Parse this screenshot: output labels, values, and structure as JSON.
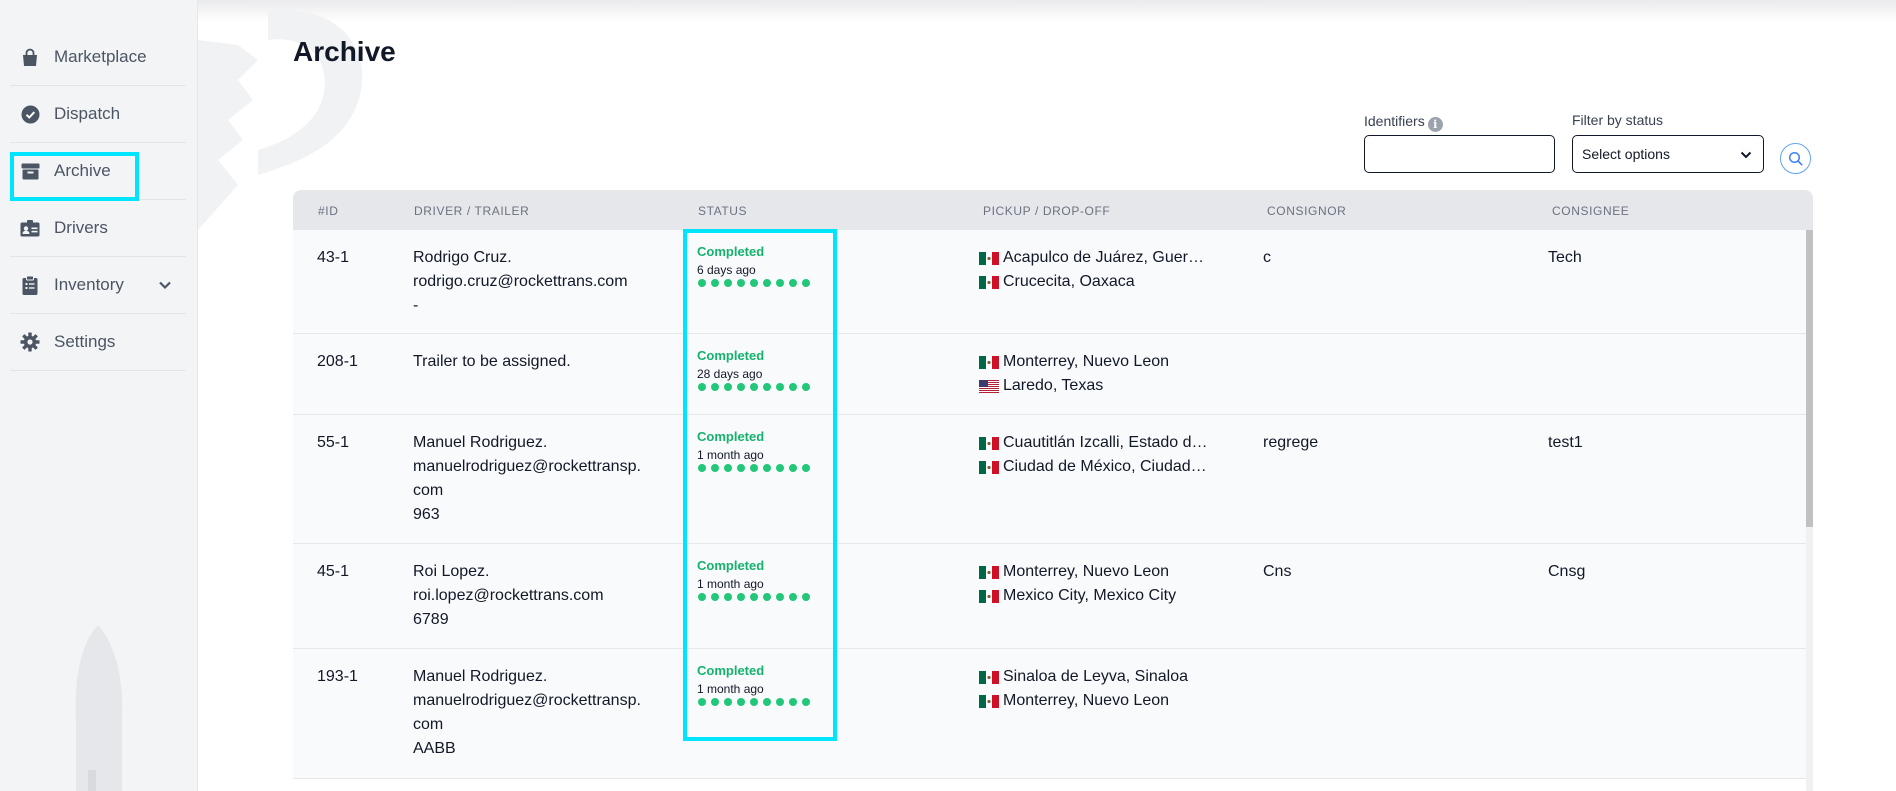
{
  "sidebar": {
    "items": [
      {
        "label": "Marketplace",
        "icon": "shopping-bag-icon",
        "active": false
      },
      {
        "label": "Dispatch",
        "icon": "check-circle-icon",
        "active": false
      },
      {
        "label": "Archive",
        "icon": "archive-box-icon",
        "active": true
      },
      {
        "label": "Drivers",
        "icon": "id-card-icon",
        "active": false
      },
      {
        "label": "Inventory",
        "icon": "clipboard-icon",
        "active": false,
        "expandable": true
      },
      {
        "label": "Settings",
        "icon": "gear-icon",
        "active": false
      }
    ]
  },
  "page": {
    "title": "Archive"
  },
  "filters": {
    "identifiers_label": "Identifiers",
    "identifiers_value": "",
    "status_label": "Filter by status",
    "status_placeholder": "Select options"
  },
  "table": {
    "headers": [
      "#ID",
      "DRIVER / TRAILER",
      "STATUS",
      "PICKUP / DROP-OFF",
      "CONSIGNOR",
      "CONSIGNEE"
    ],
    "rows": [
      {
        "id": "43-1",
        "driver_lines": [
          "Rodrigo Cruz.",
          "rodrigo.cruz@rockettrans.com",
          "-"
        ],
        "status": "Completed",
        "status_time": "6 days ago",
        "pickup": {
          "flag": "MX",
          "text": "Acapulco de Juárez, Guerr…"
        },
        "dropoff": {
          "flag": "MX",
          "text": "Crucecita, Oaxaca"
        },
        "consignor": "c",
        "consignee": "Tech"
      },
      {
        "id": "208-1",
        "driver_lines": [
          "Trailer to be assigned."
        ],
        "status": "Completed",
        "status_time": "28 days ago",
        "pickup": {
          "flag": "MX",
          "text": "Monterrey, Nuevo Leon"
        },
        "dropoff": {
          "flag": "US",
          "text": "Laredo, Texas"
        },
        "consignor": "",
        "consignee": ""
      },
      {
        "id": "55-1",
        "driver_lines": [
          "Manuel Rodriguez.",
          "manuelrodriguez@rockettransp.",
          "com",
          "963"
        ],
        "status": "Completed",
        "status_time": "1 month ago",
        "pickup": {
          "flag": "MX",
          "text": "Cuautitlán Izcalli, Estado d…"
        },
        "dropoff": {
          "flag": "MX",
          "text": "Ciudad de México, Ciudad …"
        },
        "consignor": "regrege",
        "consignee": "test1"
      },
      {
        "id": "45-1",
        "driver_lines": [
          "Roi Lopez.",
          "roi.lopez@rockettrans.com",
          "6789"
        ],
        "status": "Completed",
        "status_time": "1 month ago",
        "pickup": {
          "flag": "MX",
          "text": "Monterrey, Nuevo Leon"
        },
        "dropoff": {
          "flag": "MX",
          "text": "Mexico City, Mexico City"
        },
        "consignor": "Cns",
        "consignee": "Cnsg"
      },
      {
        "id": "193-1",
        "driver_lines": [
          "Manuel Rodriguez.",
          "manuelrodriguez@rockettransp.",
          "com",
          "AABB"
        ],
        "status": "Completed",
        "status_time": "1 month ago",
        "pickup": {
          "flag": "MX",
          "text": "Sinaloa de Leyva, Sinaloa"
        },
        "dropoff": {
          "flag": "MX",
          "text": "Monterrey, Nuevo Leon"
        },
        "consignor": "",
        "consignee": ""
      }
    ]
  },
  "colors": {
    "highlight": "#00e5ff",
    "status_completed": "#16b26d",
    "progress_dot": "#22c77a"
  }
}
